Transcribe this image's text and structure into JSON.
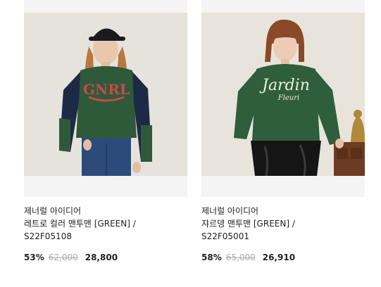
{
  "products": [
    {
      "brand": "제너럴 아이디어",
      "name_line1": "레트로 컬러 맨투맨 [GREEN] /",
      "name_line2": "S22F05108",
      "discount": "53%",
      "original_price": "62,000",
      "sale_price": "28,800",
      "print_text": "GNRL"
    },
    {
      "brand": "제너럴 아이디어",
      "name_line1": "쟈르뎅 맨투맨 [GREEN] /",
      "name_line2": "S22F05001",
      "discount": "58%",
      "original_price": "65,000",
      "sale_price": "26,910",
      "print_text_1": "Jardin",
      "print_text_2": "Fleuri"
    }
  ],
  "colors": {
    "sweater_green": "#2f5a3a",
    "thumb_bg": "#f4f4f4",
    "strike": "#aaaaaa"
  }
}
